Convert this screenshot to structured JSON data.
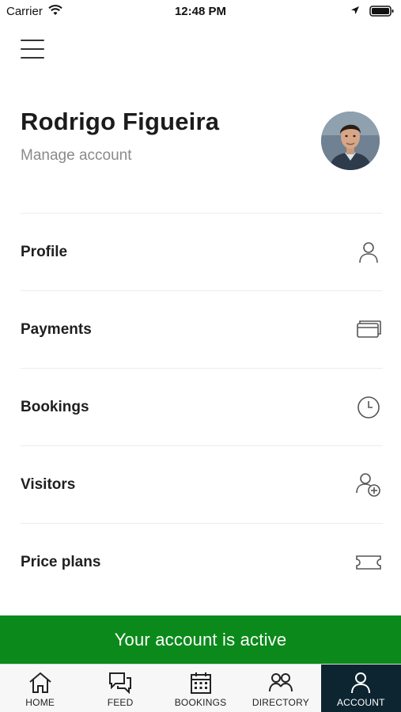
{
  "status_bar": {
    "carrier": "Carrier",
    "time": "12:48 PM"
  },
  "profile": {
    "name": "Rodrigo Figueira",
    "manage_label": "Manage account"
  },
  "menu": {
    "items": [
      {
        "label": "Profile",
        "icon": "person-icon"
      },
      {
        "label": "Payments",
        "icon": "cards-icon"
      },
      {
        "label": "Bookings",
        "icon": "clock-icon"
      },
      {
        "label": "Visitors",
        "icon": "add-person-icon"
      },
      {
        "label": "Price plans",
        "icon": "ticket-icon"
      }
    ]
  },
  "banner": {
    "text": "Your account is active",
    "color": "#0b8a1b"
  },
  "tab_bar": {
    "active_color": "#0d2531",
    "tabs": [
      {
        "label": "HOME",
        "icon": "home-icon"
      },
      {
        "label": "FEED",
        "icon": "chat-bubbles-icon"
      },
      {
        "label": "BOOKINGS",
        "icon": "calendar-icon"
      },
      {
        "label": "DIRECTORY",
        "icon": "people-icon"
      },
      {
        "label": "ACCOUNT",
        "icon": "person-icon",
        "active": true
      }
    ]
  }
}
